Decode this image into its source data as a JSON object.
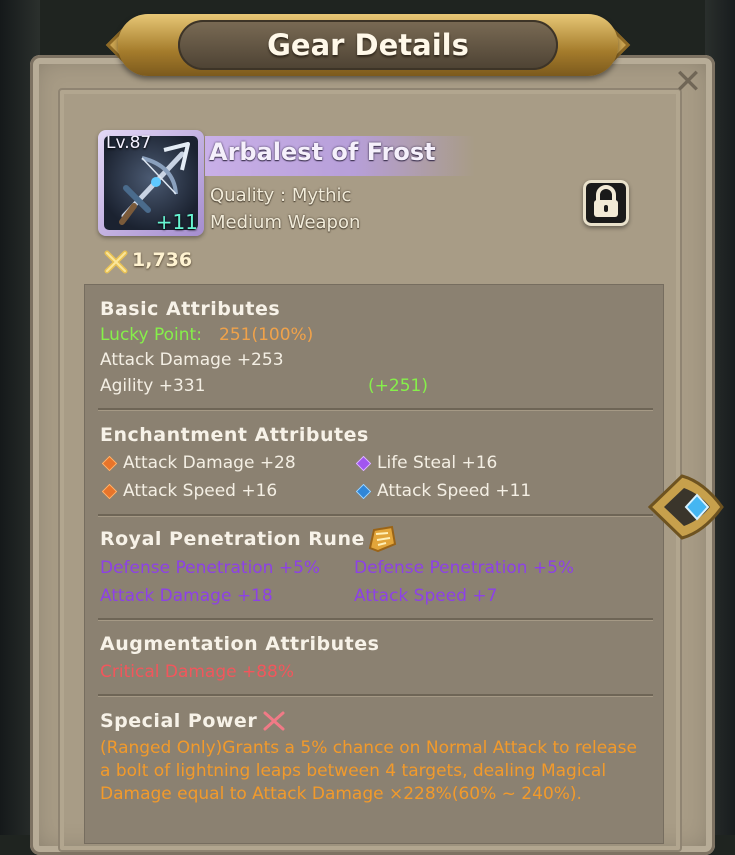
{
  "window": {
    "title": "Gear Details",
    "close_glyph": "✕"
  },
  "item": {
    "level": "Lv.87",
    "enhance": "+11",
    "name": "Arbalest of Frost",
    "quality": "Quality : Mythic",
    "type": "Medium Weapon",
    "power": "1,736",
    "icon": "crossbow-icon",
    "lock_icon": "lock-icon"
  },
  "basic": {
    "header": "Basic Attributes",
    "lucky_label": "Lucky Point:",
    "lucky_value": "251(100%)",
    "attack": "Attack Damage +253",
    "agility": "Agility +331",
    "agility_bonus": "(+251)"
  },
  "enchantment": {
    "header": "Enchantment Attributes",
    "items": [
      {
        "text": "Attack Damage +28",
        "gem": "orange"
      },
      {
        "text": "Life Steal +16",
        "gem": "purple"
      },
      {
        "text": "Attack Speed +16",
        "gem": "orange"
      },
      {
        "text": "Attack Speed +11",
        "gem": "blue"
      }
    ]
  },
  "rune": {
    "header": "Royal Penetration Rune",
    "items": [
      "Defense Penetration +5%",
      "Defense Penetration +5%",
      "Attack Damage +18",
      "Attack Speed +7"
    ]
  },
  "augmentation": {
    "header": "Augmentation Attributes",
    "line": "Critical Damage +88%"
  },
  "special": {
    "header": "Special Power",
    "description": "(Ranged Only)Grants a 5% chance on Normal Attack to release a bolt of lightning leaps between 4 targets, dealing Magical Damage equal to Attack Damage ×228%(60% ~ 240%)."
  },
  "colors": {
    "panel": "#a89c86",
    "attr_box": "#8b8171",
    "mythic_frame": "#a58dcf",
    "green": "#86f04a",
    "orange": "#f3a62c",
    "purple": "#8d41e6",
    "red": "#f2565c"
  }
}
